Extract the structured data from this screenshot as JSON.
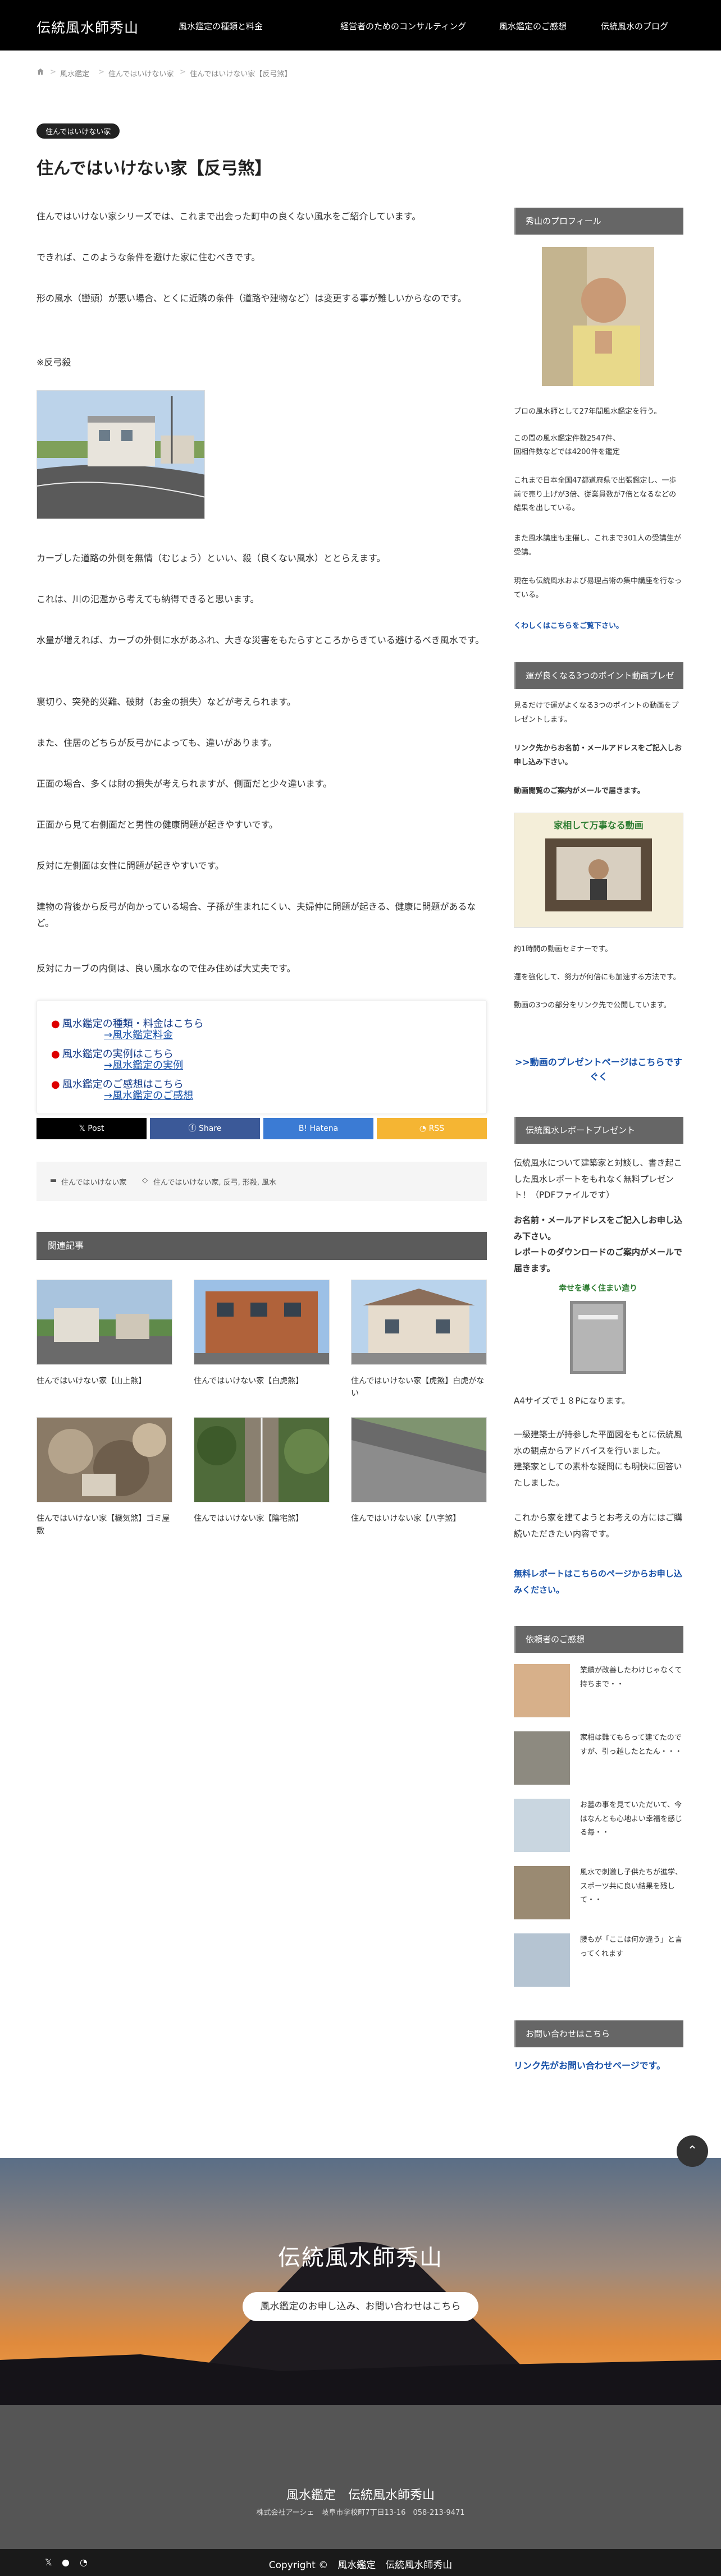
{
  "header": {
    "logo": "伝統風水師秀山",
    "nav": [
      "風水鑑定の種類と料金",
      "経営者のためのコンサルティング",
      "風水鑑定のご感想",
      "伝統風水のブログ"
    ]
  },
  "breadcrumb": {
    "items": [
      "風水鑑定",
      "住んではいけない家",
      "住んではいけない家【反弓煞】"
    ]
  },
  "article": {
    "category": "住んではいけない家",
    "title": "住んではいけない家【反弓煞】",
    "paragraphs": [
      "住んではいけない家シリーズでは、これまで出会った町中の良くない風水をご紹介しています。",
      "できれば、このような条件を避けた家に住むべきです。",
      "形の風水（巒頭）が悪い場合、とくに近隣の条件（道路や建物など）は変更する事が難しいからなのです。",
      "※反弓殺",
      "カーブした道路の外側を無情（むじょう）といい、殺（良くない風水）ととらえます。",
      "これは、川の氾濫から考えても納得できると思います。",
      "水量が増えれば、カーブの外側に水があふれ、大きな災害をもたらすところからきている避けるべき風水です。",
      "裏切り、突発的災難、破財（お金の損失）などが考えられます。",
      "また、住居のどちらが反弓かによっても、違いがあります。",
      "正面の場合、多くは財の損失が考えられますが、側面だと少々違います。",
      "正面から見て右側面だと男性の健康問題が起きやすいです。",
      "反対に左側面は女性に問題が起きやすいです。",
      "建物の背後から反弓が向かっている場合、子孫が生まれにくい、夫婦仲に問題が起きる、健康に問題があるなど。",
      "反対にカーブの内側は、良い風水なので住み住めば大丈夫です。"
    ],
    "links": [
      {
        "title": "風水鑑定の種類・料金はこちら",
        "sub": "→風水鑑定料金"
      },
      {
        "title": "風水鑑定の実例はこちら",
        "sub": "→風水鑑定の実例"
      },
      {
        "title": "風水鑑定のご感想はこちら",
        "sub": "→風水鑑定のご感想"
      }
    ],
    "share": [
      "Post",
      "Share",
      "Hatena",
      "RSS"
    ],
    "share_colors": [
      "#000000",
      "#3b5998",
      "#3b7bd4",
      "#f5b533"
    ],
    "meta_category": "住んではいけない家",
    "meta_tags": "住んではいけない家, 反弓, 形殺, 風水"
  },
  "related": {
    "heading": "関連記事",
    "items": [
      "住んではいけない家【山上煞】",
      "住んではいけない家【白虎煞】",
      "住んではいけない家【虎煞】白虎がない",
      "住んではいけない家【穢気煞】ゴミ屋敷",
      "住んではいけない家【陰宅煞】",
      "住んではいけない家【八字煞】"
    ]
  },
  "sidebar": {
    "profile_head": "秀山のプロフィール",
    "profile_text": [
      "プロの風水師として27年間風水鑑定を行う。",
      "この間の風水鑑定件数2547件、",
      "回相件数などでは4200件を鑑定",
      "これまで日本全国47都道府県で出張鑑定し、一歩前で売り上げが3倍、従業員数が7倍となるなどの結果を出している。",
      "また風水講座も主催し、これまで301人の受講生が受講。",
      "現在も伝統風水および易理占術の集中講座を行なっている。"
    ],
    "profile_link": "くわしくはこちらをご覧下さい。",
    "video_head": "運が良くなる3つのポイント動画プレゼ",
    "video_text1": "見るだけで運がよくなる3つのポイントの動画をプレゼントします。",
    "video_text2": "リンク先からお名前・メールアドレスをご記入しお申し込み下さい。",
    "video_text3": "動画閲覧のご案内がメールで届きます。",
    "video_banner": "家相して万事なる動画",
    "video_text4": "約1時間の動画セミナーです。",
    "video_text5": "運を強化して、努力が何倍にも加速する方法です。",
    "video_text6": "動画の3つの部分をリンク先で公開しています。",
    "video_link": ">>動画のプレゼントページはこちらですぐく",
    "report_head": "伝統風水レポートプレゼント",
    "report_text1": "伝統風水について建築家と対談し、書き起こした風水レポートをもれなく無料プレゼント！（PDFファイルです）",
    "report_text2": "お名前・メールアドレスをご記入しお申し込み下さい。\nレポートのダウンロードのご案内がメールで届きます。",
    "report_banner": "幸せを導く住まい造り",
    "report_text3": "A4サイズで１８Pになります。",
    "report_text4": "一級建築士が持参した平面図をもとに伝統風水の観点からアドバイスを行いました。\n建築家としての素朴な疑問にも明快に回答いたしました。",
    "report_text5": "これから家を建てようとお考えの方にはご購読いただきたい内容です。",
    "report_link": "無料レポートはこちらのページからお申し込みください。",
    "voices_head": "依頼者のご感想",
    "voices": [
      "業績が改善したわけじゃなくて持ちまで・・",
      "家相は難てもらって建てたのですが、引っ越したとたん・・・",
      "お墓の事を見ていただいて、今はなんとも心地よい幸福を感じる毎・・",
      "風水で刺激し子供たちが進学、スポーツ共に良い結果を残して・・",
      "腰もが「ここは何か違う」と言ってくれます"
    ],
    "contact_head": "お問い合わせはこちら",
    "contact_link": "リンク先がお問い合わせページです。"
  },
  "footer": {
    "hero_title": "伝統風水師秀山",
    "hero_button": "風水鑑定のお申し込み、お問い合わせはこちら",
    "name": "風水鑑定　伝統風水師秀山",
    "address": "株式会社アーシェ　岐阜市学校町7丁目13-16　058-213-9471",
    "copyright": "Copyright ©　風水鑑定　伝統風水師秀山"
  }
}
